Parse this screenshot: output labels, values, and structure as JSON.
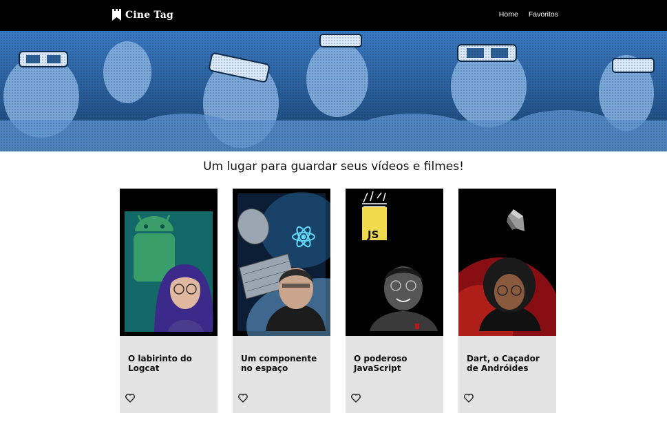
{
  "header": {
    "logo_text": "Cine Tag",
    "nav": [
      {
        "label": "Home"
      },
      {
        "label": "Favoritos"
      }
    ]
  },
  "subtitle": "Um lugar para guardar seus vídeos e filmes!",
  "cards": [
    {
      "title": "O labirinto do Logcat",
      "thumbnail_icon": "android-icon",
      "accent": "#1b8f8c"
    },
    {
      "title": "Um componente no espaço",
      "thumbnail_icon": "react-icon",
      "accent": "#2a6ea6"
    },
    {
      "title": "O poderoso JavaScript",
      "thumbnail_icon": "javascript-icon",
      "accent": "#f0db4f",
      "logo_text": "JS"
    },
    {
      "title": "Dart, o Caçador de Andróides",
      "thumbnail_icon": "dart-icon",
      "accent": "#c0161b"
    }
  ],
  "icons": {
    "logo": "clapperboard-icon",
    "favorite": "heart-outline-icon"
  },
  "colors": {
    "header_bg": "#000000",
    "banner_tint": "#2b6cb0",
    "card_bg": "#e3e3e3"
  }
}
